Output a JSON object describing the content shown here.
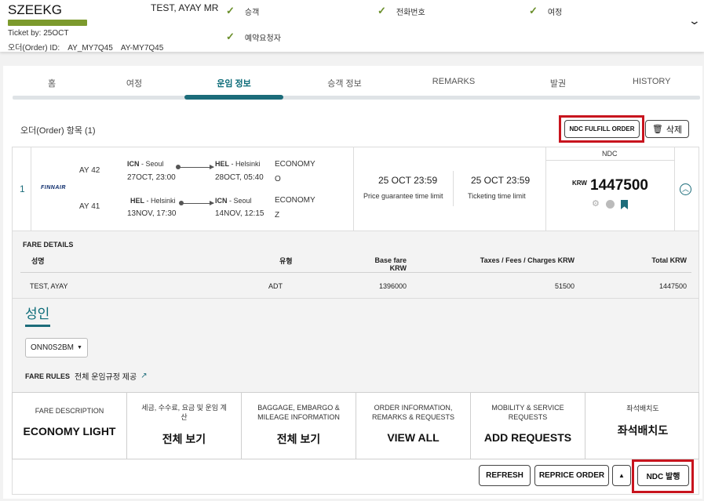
{
  "header": {
    "pnr": "SZEEKG",
    "ticket_by": "Ticket by: 25OCT",
    "order_id_label": "오더(Order) ID:",
    "order_id_1": "AY_MY7Q45",
    "order_id_2": "AY-MY7Q45",
    "passenger": "TEST, AYAY MR",
    "checks": [
      "승객",
      "전화번호",
      "여정",
      "예약요청자"
    ]
  },
  "tabs": [
    "홈",
    "여정",
    "운임 정보",
    "승객 정보",
    "REMARKS",
    "발권",
    "HISTORY"
  ],
  "active_tab": "운임 정보",
  "order": {
    "title": "오더(Order) 항목 (1)",
    "fulfill_button": "NDC FULFILL ORDER",
    "delete_button": "삭제",
    "row_number": "1",
    "airline_logo": "FINNAIR",
    "flights": [
      {
        "flight_no": "AY 42",
        "from_code": "ICN",
        "from_city": "Seoul",
        "dep": "27OCT, 23:00",
        "to_code": "HEL",
        "to_city": "Helsinki",
        "arr": "28OCT, 05:40",
        "cabin": "ECONOMY",
        "class": "O"
      },
      {
        "flight_no": "AY 41",
        "from_code": "HEL",
        "from_city": "Helsinki",
        "dep": "13NOV, 17:30",
        "to_code": "ICN",
        "to_city": "Seoul",
        "arr": "14NOV, 12:15",
        "cabin": "ECONOMY",
        "class": "Z"
      }
    ],
    "price_guarantee_date": "25 OCT 23:59",
    "price_guarantee_label": "Price guarantee time limit",
    "ticketing_date": "25 OCT 23:59",
    "ticketing_label": "Ticketing time limit",
    "ndc_label": "NDC",
    "currency": "KRW",
    "total": "1447500"
  },
  "fare_details": {
    "title": "FARE DETAILS",
    "headers": [
      "성명",
      "유형",
      "Base fare KRW",
      "Taxes / Fees / Charges KRW",
      "Total KRW"
    ],
    "row": [
      "TEST, AYAY",
      "ADT",
      "1396000",
      "51500",
      "1447500"
    ]
  },
  "adult": {
    "title": "성인",
    "fare_basis": "ONN0S2BM",
    "fare_rules_label": "FARE RULES",
    "fare_rules_link": "전체 운임규정 제공"
  },
  "tiles": [
    {
      "small": "FARE DESCRIPTION",
      "big": "ECONOMY LIGHT"
    },
    {
      "small": "세금, 수수료, 요금 및 운임 계산",
      "big": "전체 보기"
    },
    {
      "small": "BAGGAGE, EMBARGO & MILEAGE INFORMATION",
      "big": "전체 보기"
    },
    {
      "small": "ORDER INFORMATION, REMARKS & REQUESTS",
      "big": "VIEW ALL"
    },
    {
      "small": "MOBILITY & SERVICE REQUESTS",
      "big": "ADD REQUESTS"
    },
    {
      "small": "좌석배치도",
      "big": "좌석배치도"
    }
  ],
  "footer": {
    "refresh": "REFRESH",
    "reprice": "REPRICE ORDER",
    "ndc_issue": "NDC 발행"
  },
  "colors": {
    "accent": "#0b6b78",
    "highlight_box": "#c8141e",
    "check": "#6a8f2b"
  }
}
